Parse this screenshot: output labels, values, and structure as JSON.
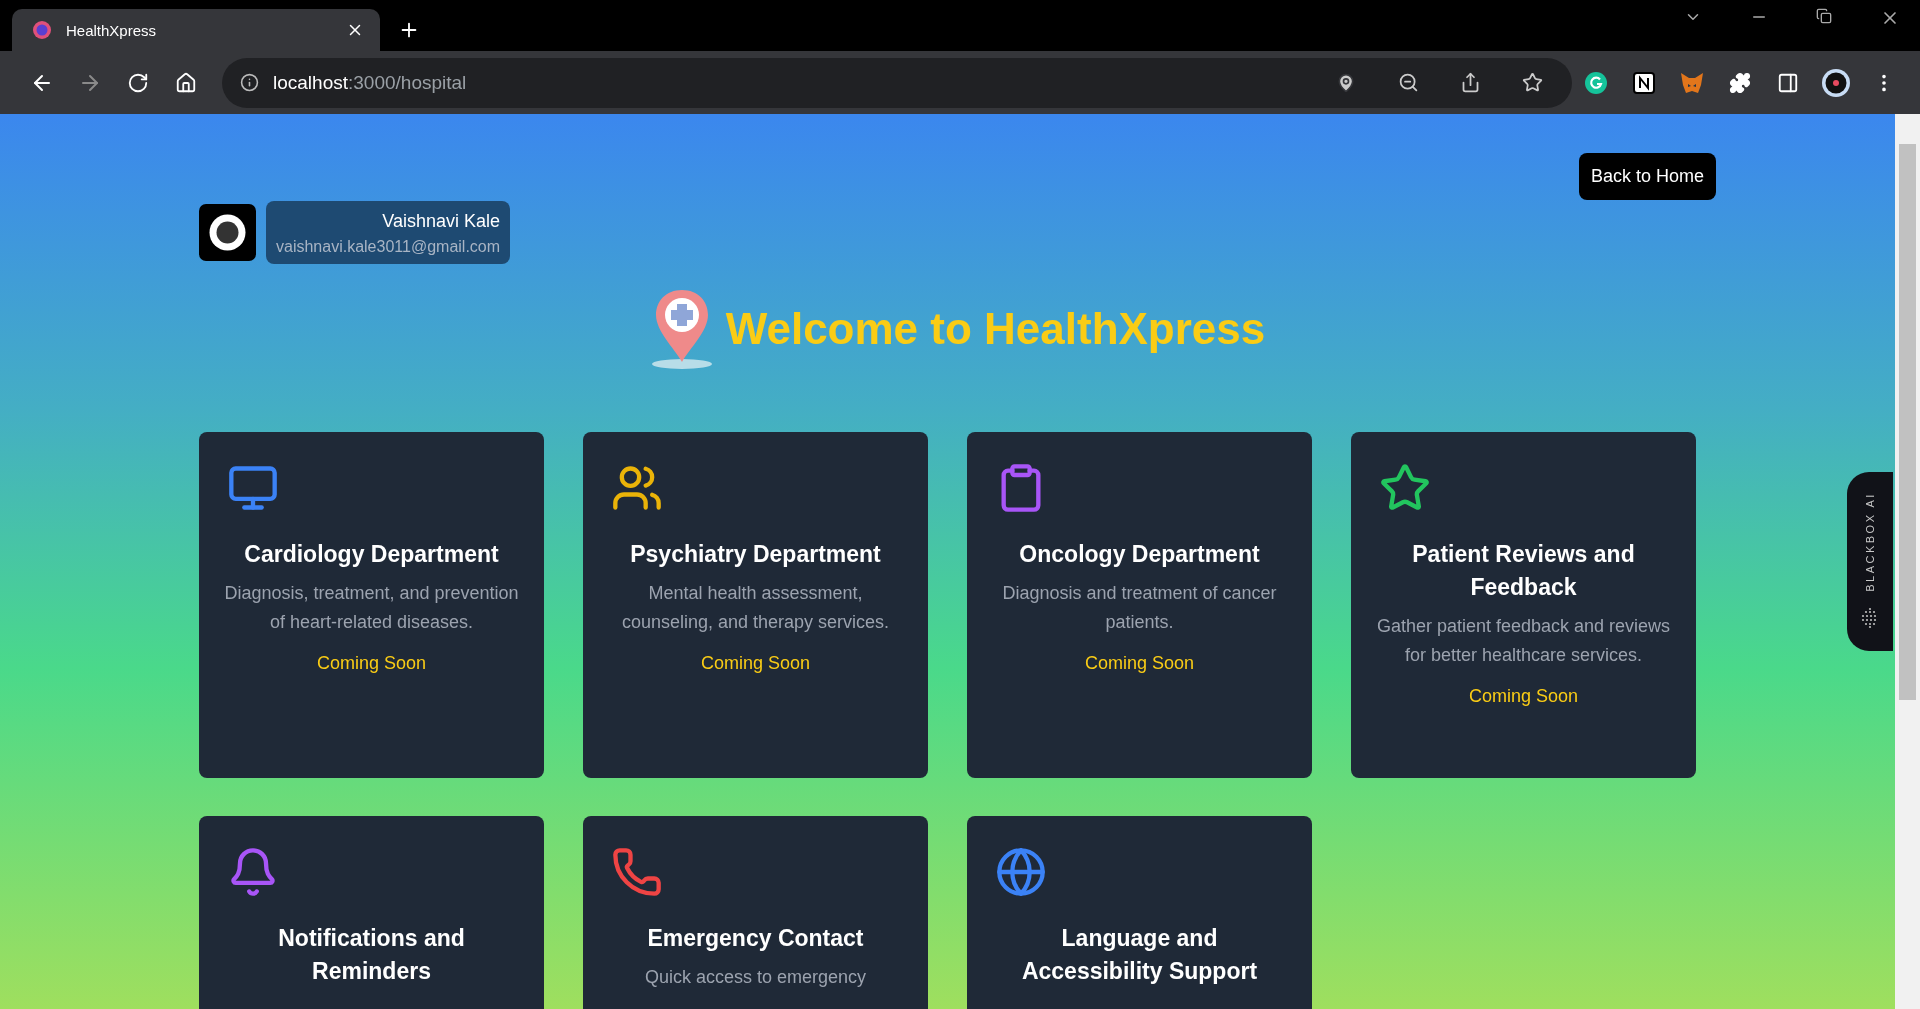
{
  "browser": {
    "tab": {
      "title": "HealthXpress"
    },
    "address": {
      "host": "localhost",
      "path": ":3000/hospital"
    }
  },
  "page": {
    "back_button": "Back to Home",
    "user": {
      "name": "Vaishnavi Kale",
      "email": "vaishnavi.kale3011@gmail.com"
    },
    "title": "Welcome to HealthXpress",
    "cards": [
      {
        "title": "Cardiology Department",
        "description": "Diagnosis, treatment, and prevention of heart-related diseases.",
        "status": "Coming Soon",
        "color": "#3b82f6"
      },
      {
        "title": "Psychiatry Department",
        "description": "Mental health assessment, counseling, and therapy services.",
        "status": "Coming Soon",
        "color": "#eab308"
      },
      {
        "title": "Oncology Department",
        "description": "Diagnosis and treatment of cancer patients.",
        "status": "Coming Soon",
        "color": "#a855f7"
      },
      {
        "title": "Patient Reviews and Feedback",
        "description": "Gather patient feedback and reviews for better healthcare services.",
        "status": "Coming Soon",
        "color": "#22c55e"
      },
      {
        "title": "Notifications and Reminders",
        "color": "#a855f7"
      },
      {
        "title": "Emergency Contact",
        "description": "Quick access to emergency",
        "color": "#ef4444"
      },
      {
        "title": "Language and Accessibility Support",
        "color": "#3b82f6"
      }
    ]
  },
  "side_widget": {
    "label": "BLACKBOX AI"
  }
}
